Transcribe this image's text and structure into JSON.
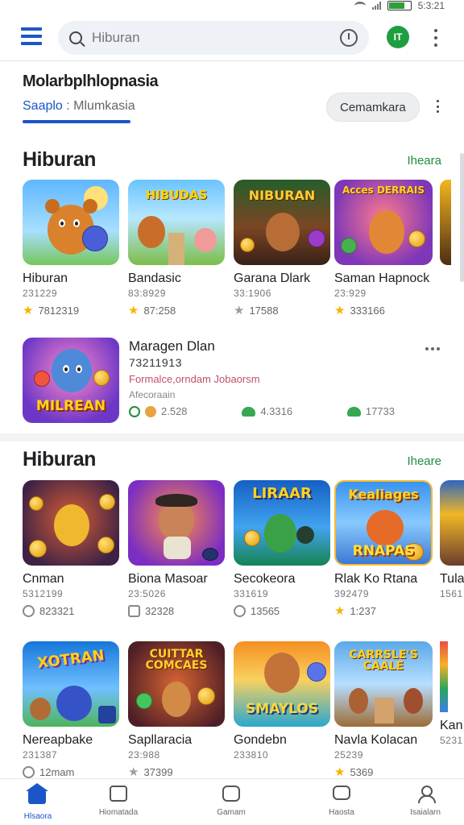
{
  "status_bar": {
    "time": "5:3:21",
    "battery_level": 0.72
  },
  "search": {
    "placeholder": "Hiburan"
  },
  "account": {
    "avatar_initials": "IT"
  },
  "header": {
    "title": "Molarbplhlopnasia",
    "subtitle_blue": "Saaplo",
    "subtitle_sep": " : ",
    "subtitle_gray": "Mlumkasia",
    "pill_button": "Cemamkara"
  },
  "sections": [
    {
      "title": "Hiburan",
      "more_label": "Iheara",
      "tiles": [
        {
          "name": "Hiburan",
          "code": "231229",
          "rating": "7812319",
          "art": "bear"
        },
        {
          "name": "Bandasic",
          "code": "83:8929",
          "rating": "87:258",
          "art": "hibudas",
          "thumb_text": "HIBUDAS"
        },
        {
          "name": "Garana Dlark",
          "code": "33:1906",
          "rating": "17588",
          "art": "niburan",
          "thumb_text": "NIBURAN"
        },
        {
          "name": "Saman Hapnock",
          "code": "23:929",
          "rating": "333166",
          "art": "scenes",
          "thumb_text": "Acces DERRAIS"
        }
      ],
      "feature": {
        "title": "Maragen Dlan",
        "code": "73211913",
        "description": "Formalce,orndam Jobaorsm",
        "tag": "Afecoraain",
        "thumb_text": "MILREAN",
        "meta": [
          "2.528",
          "4.3316",
          "17733"
        ]
      }
    },
    {
      "title": "Hiburan",
      "more_label": "Iheare",
      "tiles": [
        {
          "name": "Cnman",
          "code": "5312199",
          "rating": "823321",
          "art": "coins"
        },
        {
          "name": "Biona Masoar",
          "code": "23:5026",
          "rating": "32328",
          "art": "pirate"
        },
        {
          "name": "Secokeora",
          "code": "331619",
          "rating": "13565",
          "art": "liraar",
          "thumb_text": "LIRAAR"
        },
        {
          "name": "Rlak Ko Rtana",
          "code": "392479",
          "rating": "1:237",
          "art": "kealiages",
          "thumb_text": "Kealiages"
        },
        {
          "name": "Tula",
          "code": "1561",
          "rating": "",
          "art": "partial"
        }
      ]
    },
    {
      "tiles": [
        {
          "name": "Nereapbake",
          "code": "231387",
          "rating": "12mam",
          "art": "xotran",
          "thumb_text": "XOTRAN"
        },
        {
          "name": "Sapllaracia",
          "code": "23:988",
          "rating": "37399",
          "art": "comcaes",
          "thumb_text": "CUITTAR COMCAES"
        },
        {
          "name": "Gondebn",
          "code": "233810",
          "rating": "",
          "art": "smaylos",
          "thumb_text": "SMAYLOS"
        },
        {
          "name": "Navla Kolacan",
          "code": "25239",
          "rating": "5369",
          "art": "carsale",
          "thumb_text": "CARRSLE'S CAALE"
        },
        {
          "name": "Kan",
          "code": "5231",
          "rating": "",
          "art": "partial"
        }
      ]
    }
  ],
  "bottom_nav": [
    {
      "label": "Hlsaora",
      "icon": "home-icon",
      "active": true
    },
    {
      "label": "Hiomatada",
      "icon": "puzzle-icon",
      "active": false
    },
    {
      "label": "Gamam",
      "icon": "game-icon",
      "active": false
    },
    {
      "label": "Haosta",
      "icon": "chat-icon",
      "active": false
    },
    {
      "label": "Isaialarn",
      "icon": "profile-icon",
      "active": false
    }
  ],
  "colors": {
    "accent_blue": "#1a56c8",
    "accent_green": "#1e8e3e",
    "star_yellow": "#f5b400"
  }
}
